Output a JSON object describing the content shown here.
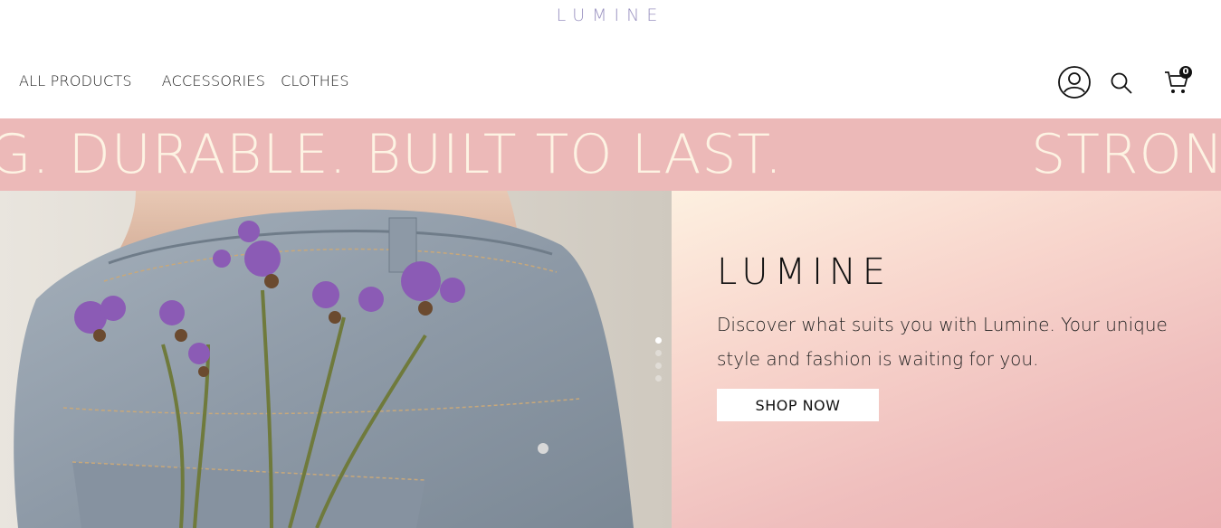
{
  "header": {
    "logo": "LUMINE",
    "nav": [
      {
        "label": "ALL PRODUCTS"
      },
      {
        "label": "ACCESSORIES"
      },
      {
        "label": "CLOTHES"
      }
    ],
    "icons": [
      "user-icon",
      "search-icon",
      "cart-icon"
    ],
    "cart_count": "0"
  },
  "marquee": {
    "text_1": "G. DURABLE. BUILT TO LAST.",
    "text_2": "STRONG"
  },
  "hero": {
    "title": "LUMINE",
    "subtitle": "Discover what suits you with Lumine. Your unique style and fashion is waiting for you.",
    "cta_label": "SHOP NOW",
    "slides_total": 4,
    "active_slide": 1
  },
  "colors": {
    "logo": "#9b93c1",
    "marquee_bg": "#ecb9b8",
    "marquee_text": "#fdf3e3",
    "hero_gradient_start": "#fdf0e0",
    "hero_gradient_end": "#ebb0b2"
  }
}
